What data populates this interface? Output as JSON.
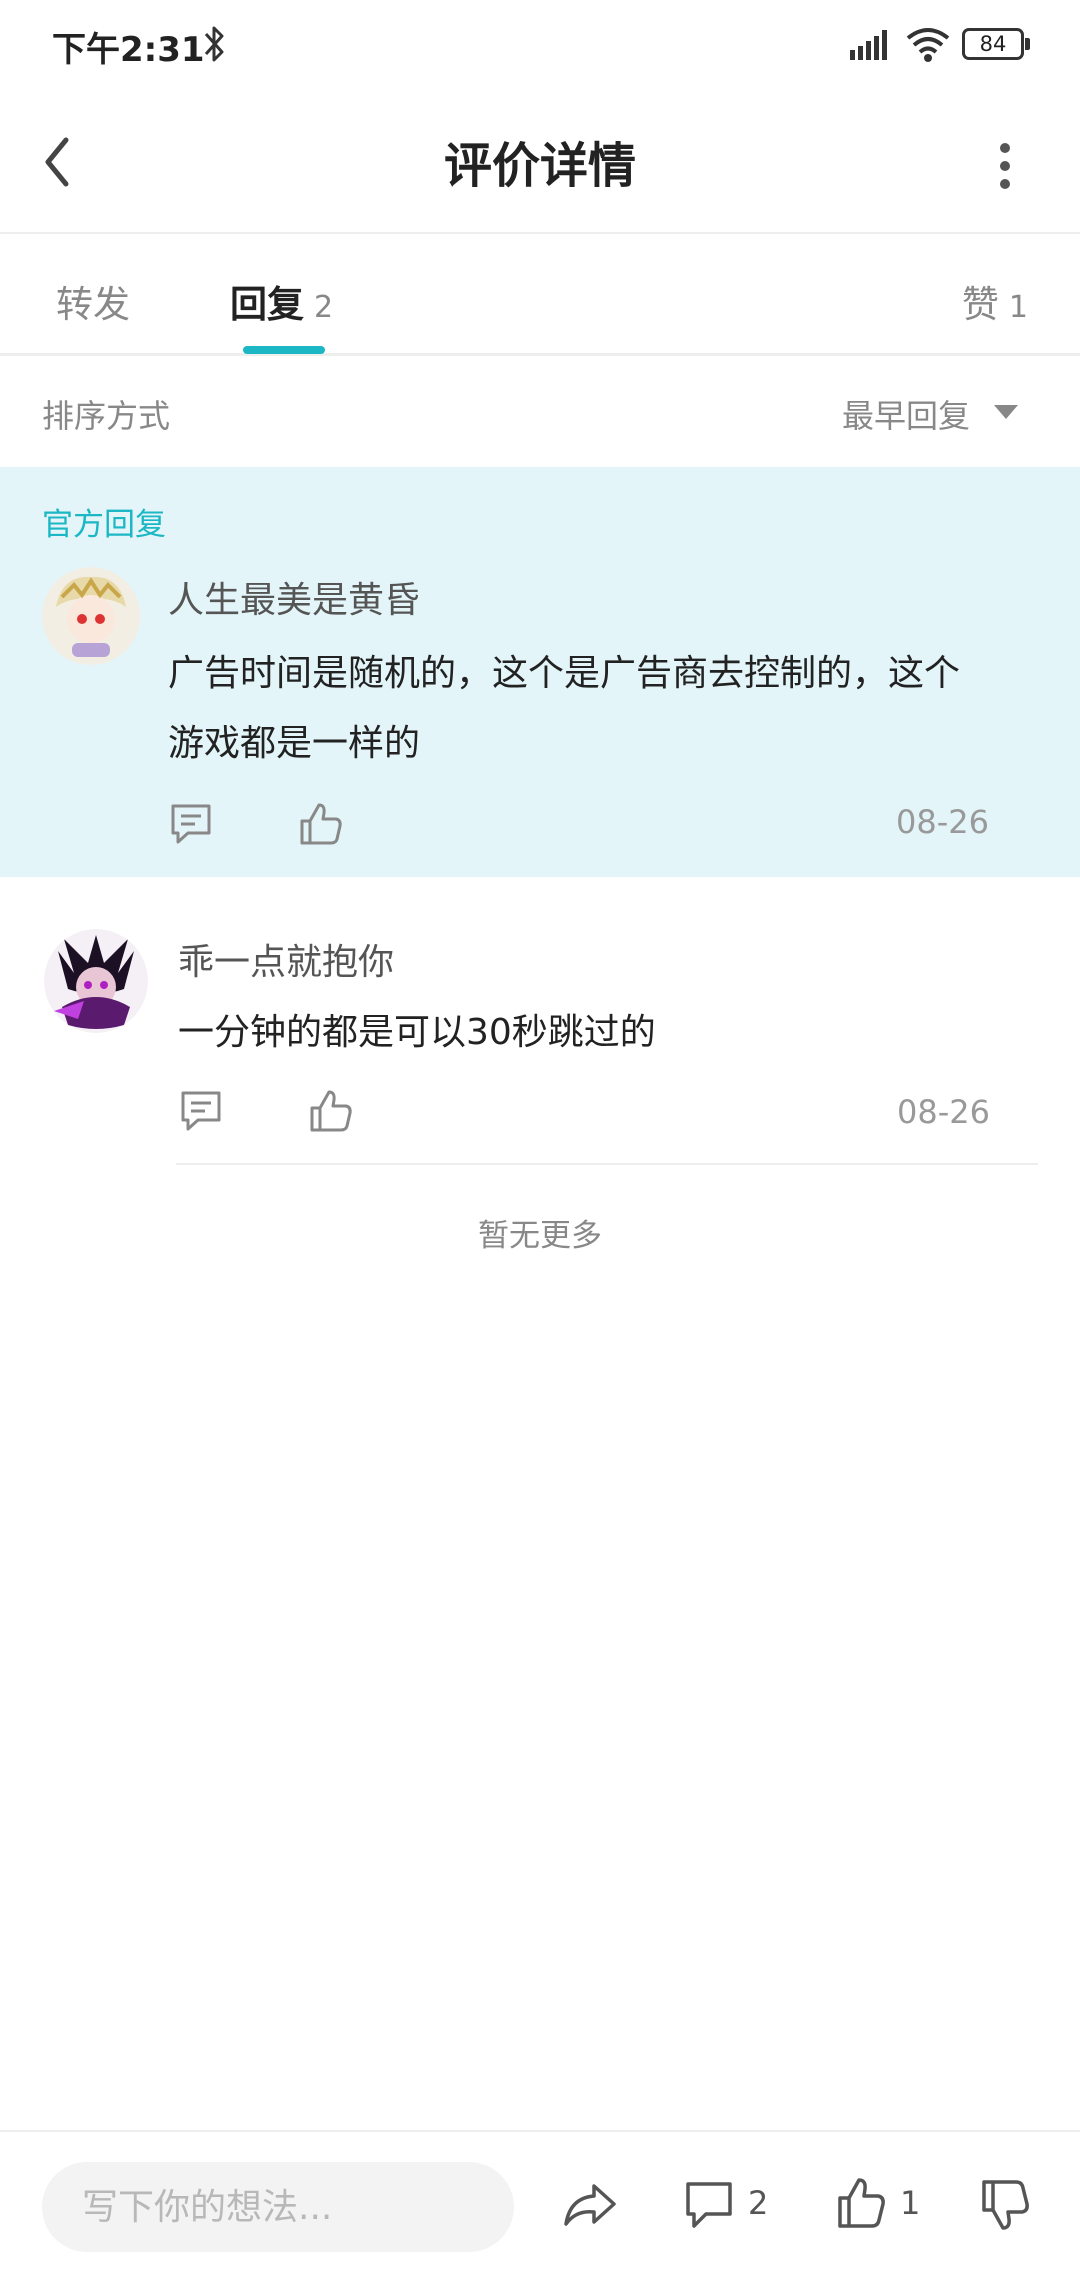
{
  "status_bar": {
    "time": "下午2:31",
    "battery": "84"
  },
  "header": {
    "title": "评价详情"
  },
  "tabs": {
    "forward_label": "转发",
    "reply_label": "回复",
    "reply_count": "2",
    "like_label": "赞",
    "like_count": "1"
  },
  "sort": {
    "label": "排序方式",
    "value": "最早回复"
  },
  "official_reply": {
    "tag": "官方回复",
    "username": "人生最美是黄昏",
    "content_line1": "广告时间是随机的，这个是广告商去控制的，这个",
    "content_line2": "游戏都是一样的",
    "date": "08-26"
  },
  "replies": [
    {
      "username": "乖一点就抱你",
      "content": "一分钟的都是可以30秒跳过的",
      "date": "08-26"
    }
  ],
  "footer_note": "暂无更多",
  "bottom_bar": {
    "input_placeholder": "写下你的想法...",
    "comment_count": "2",
    "like_count": "1"
  },
  "colors": {
    "accent": "#1cb7c4",
    "official_bg": "#e3f5f9"
  }
}
